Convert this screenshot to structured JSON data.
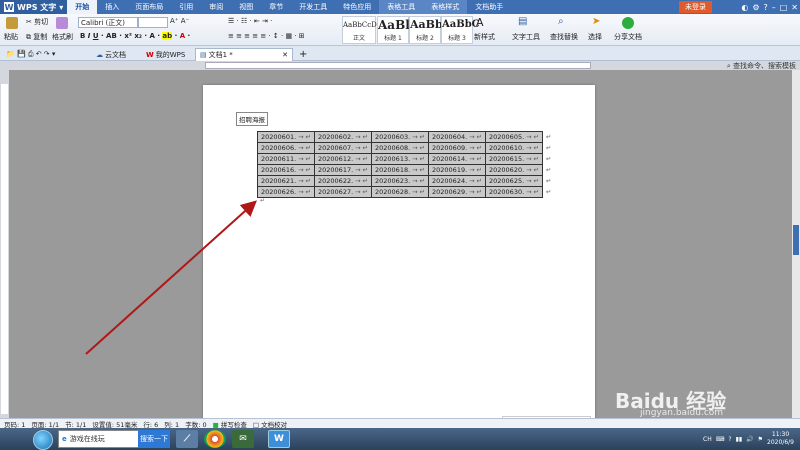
{
  "app": {
    "name": "WPS 文字",
    "login": "未登录"
  },
  "menu_tabs": [
    {
      "label": "开始",
      "active": true
    },
    {
      "label": "插入"
    },
    {
      "label": "页面布局"
    },
    {
      "label": "引用"
    },
    {
      "label": "审阅"
    },
    {
      "label": "视图"
    },
    {
      "label": "章节"
    },
    {
      "label": "开发工具"
    },
    {
      "label": "特色应用"
    },
    {
      "label": "表格工具",
      "context": true
    },
    {
      "label": "表格样式",
      "context": true
    },
    {
      "label": "文档助手"
    }
  ],
  "ribbon": {
    "paste": "粘贴",
    "cut": "剪切",
    "copy": "复制",
    "format_painter": "格式刷",
    "font_name": "Calibri (正文)",
    "styles": [
      {
        "sample": "AaBbCcDd",
        "name": "正文"
      },
      {
        "sample": "AaBl",
        "name": "标题 1"
      },
      {
        "sample": "AaBb(",
        "name": "标题 2"
      },
      {
        "sample": "AaBbC",
        "name": "标题 3"
      }
    ],
    "new_style": "新样式",
    "text_tools": "文字工具",
    "find_replace": "查找替换",
    "select": "选择",
    "share_doc": "分享文档"
  },
  "doc_tabs": [
    {
      "label": "云文档"
    },
    {
      "label": "我的WPS"
    },
    {
      "label": "文档1 *",
      "active": true
    }
  ],
  "search_cmd": "查找命令、搜索模板",
  "document": {
    "label": "招聘海报",
    "rows": [
      [
        "20200601.",
        "20200602.",
        "20200603.",
        "20200604.",
        "20200605."
      ],
      [
        "20200606.",
        "20200607.",
        "20200608.",
        "20200609.",
        "20200610."
      ],
      [
        "20200611.",
        "20200612.",
        "20200613.",
        "20200614.",
        "20200615."
      ],
      [
        "20200616.",
        "20200617.",
        "20200618.",
        "20200619.",
        "20200620."
      ],
      [
        "20200621.",
        "20200622.",
        "20200623.",
        "20200624.",
        "20200625."
      ],
      [
        "20200626.",
        "20200627.",
        "20200628.",
        "20200629.",
        "20200630."
      ]
    ],
    "cell_mark": "→ ↵",
    "row_mark": "↵",
    "para_mark": "↵"
  },
  "status": {
    "page_no": "页码: 1",
    "pages": "页面: 1/1",
    "section": "节: 1/1",
    "setting": "设置值: 51毫米",
    "row": "行: 6",
    "col": "列: 1",
    "words": "字数: 0",
    "spell": "拼写检查",
    "proof": "文档校对"
  },
  "taskbar": {
    "search_text": "游戏在线玩",
    "search_btn": "搜索一下",
    "time": "11:30",
    "date": "2020/6/9",
    "lang": "CH"
  },
  "ime": {
    "label": "中"
  },
  "watermark": {
    "main": "Baidu 经验",
    "sub": "jingyan.baidu.com"
  },
  "colors": {
    "accent": "#3f6fb3",
    "arrow": "#b01818",
    "table_fill": "#c9c9c9"
  }
}
